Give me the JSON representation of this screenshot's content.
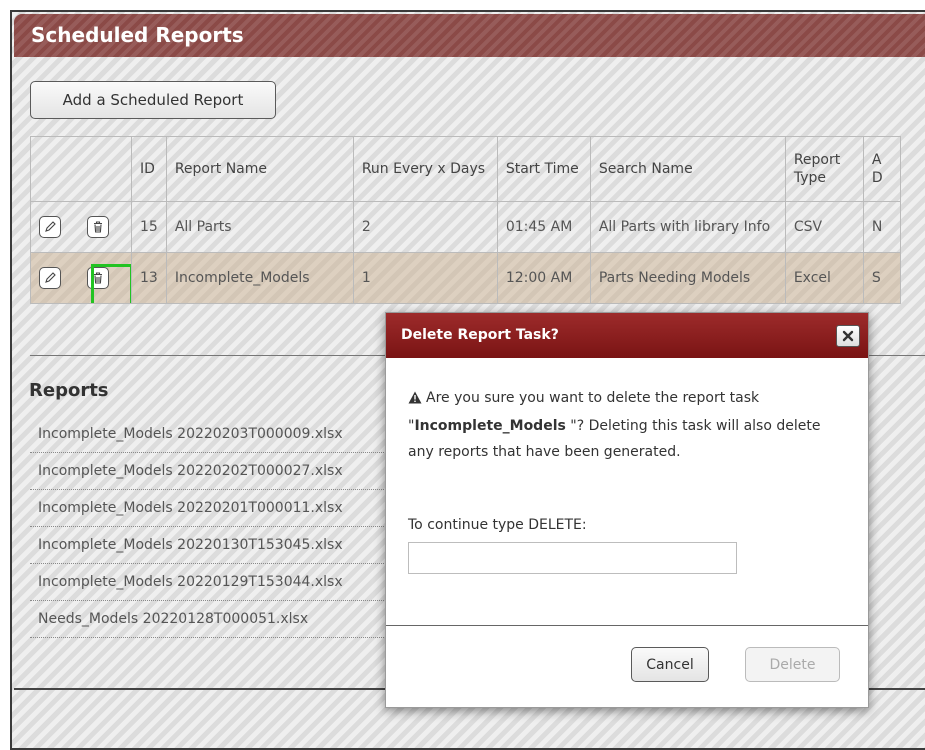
{
  "header": {
    "title": "Scheduled Reports"
  },
  "toolbar": {
    "add_label": "Add a Scheduled Report"
  },
  "table": {
    "columns": [
      "",
      "ID",
      "Report Name",
      "Run Every x Days",
      "Start Time",
      "Search Name",
      "Report Type",
      "A D"
    ],
    "rows": [
      {
        "id": "15",
        "name": "All Parts",
        "run_every": "2",
        "start_time": "01:45 AM",
        "search_name": "All Parts with library Info",
        "report_type": "CSV",
        "extra": "N"
      },
      {
        "id": "13",
        "name": "Incomplete_Models",
        "run_every": "1",
        "start_time": "12:00 AM",
        "search_name": "Parts Needing Models",
        "report_type": "Excel",
        "extra": "S"
      }
    ]
  },
  "reports": {
    "title": "Reports",
    "items": [
      "Incomplete_Models 20220203T000009.xlsx",
      "Incomplete_Models 20220202T000027.xlsx",
      "Incomplete_Models 20220201T000011.xlsx",
      "Incomplete_Models 20220130T153045.xlsx",
      "Incomplete_Models 20220129T153044.xlsx",
      "Needs_Models 20220128T000051.xlsx"
    ]
  },
  "dialog": {
    "title": "Delete Report Task?",
    "message_prefix": "Are you sure you want to delete the report task \"",
    "task_name": "Incomplete_Models",
    "message_suffix": " \"? Deleting this task will also delete any reports that have been generated.",
    "continue_label": "To continue type DELETE:",
    "input_value": "",
    "cancel_label": "Cancel",
    "delete_label": "Delete"
  },
  "icons": {
    "edit": "pencil-icon",
    "delete": "trash-icon",
    "close": "close-icon",
    "warning": "warning-icon"
  },
  "colors": {
    "header_bg": "#8b4a47",
    "dialog_header_bg": "#8b1e1e",
    "focus_outline": "#22c322",
    "selected_row": "#d9c4a8"
  }
}
